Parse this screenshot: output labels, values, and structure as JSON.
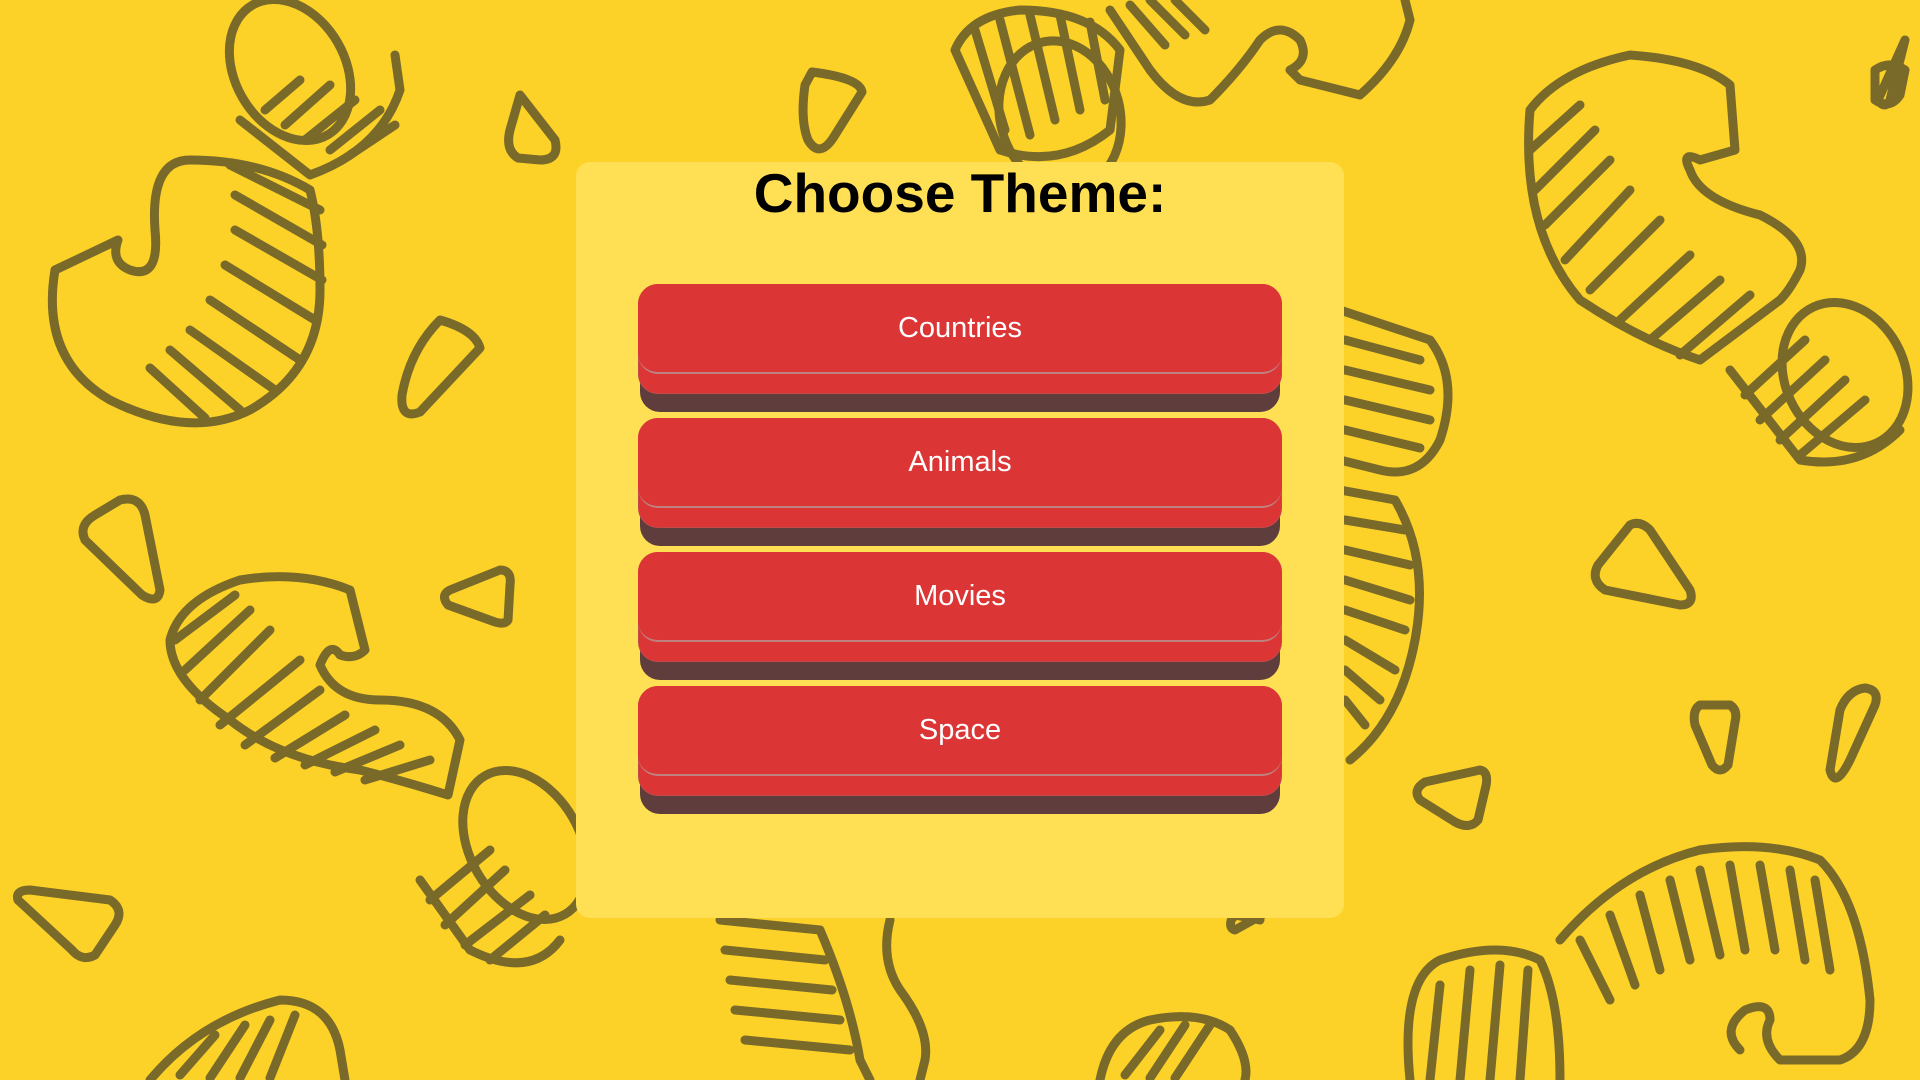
{
  "title": "Choose Theme:",
  "themes": [
    {
      "label": "Countries"
    },
    {
      "label": "Animals"
    },
    {
      "label": "Movies"
    },
    {
      "label": "Space"
    }
  ],
  "colors": {
    "background": "#fdd228",
    "panel": "#ffe055",
    "button": "#dc3535",
    "button_shadow": "#5e3d3c",
    "pattern_stroke": "#7a6a2a"
  },
  "background_pattern": "pasta-doodles"
}
